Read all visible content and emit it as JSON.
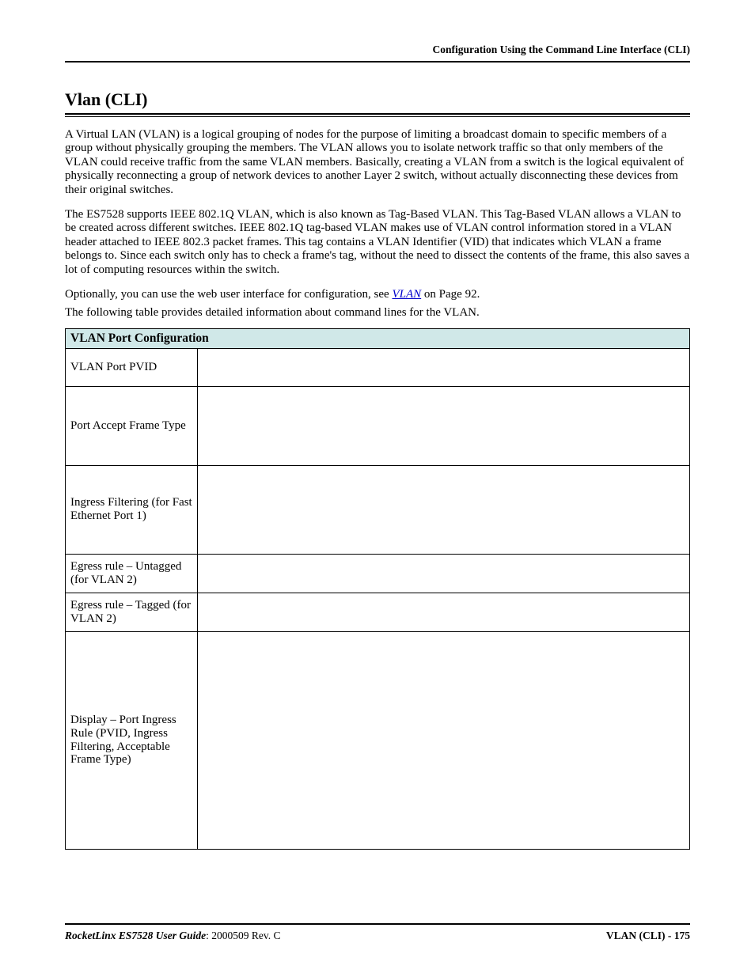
{
  "header": {
    "running_title": "Configuration Using the Command Line Interface (CLI)"
  },
  "section": {
    "title": "Vlan (CLI)",
    "para1": "A Virtual LAN (VLAN) is a logical grouping of nodes for the purpose of limiting a broadcast domain to specific members of a group without physically grouping the members. The VLAN allows you to isolate network traffic so that only members of the VLAN could receive traffic from the same VLAN members. Basically, creating a VLAN from a switch is the logical equivalent of physically reconnecting a group of network devices to another Layer 2 switch, without actually disconnecting these devices from their original switches.",
    "para2": "The ES7528 supports IEEE 802.1Q VLAN, which is also known as Tag-Based VLAN. This Tag-Based VLAN allows a VLAN to be created across different switches. IEEE 802.1Q tag-based VLAN makes use of VLAN control information stored in a VLAN header attached to IEEE 802.3 packet frames. This tag contains a VLAN Identifier (VID) that indicates which VLAN a frame belongs to. Since each switch only has to check a frame's tag, without the need to dissect the contents of the frame, this also saves a lot of computing resources within the switch.",
    "para3_pre": "Optionally, you can use the web user interface for configuration, see ",
    "para3_link": "VLAN",
    "para3_post": " on Page 92.",
    "para4": "The following table provides detailed information about command lines for the VLAN."
  },
  "table": {
    "header": "VLAN Port Configuration",
    "rows": [
      {
        "label": "VLAN Port PVID"
      },
      {
        "label": "Port Accept Frame Type"
      },
      {
        "label": "Ingress Filtering (for Fast Ethernet Port 1)"
      },
      {
        "label": "Egress rule – Untagged (for VLAN 2)"
      },
      {
        "label": "Egress rule – Tagged (for VLAN 2)"
      },
      {
        "label": "Display – Port Ingress Rule (PVID, Ingress Filtering, Acceptable Frame Type)"
      }
    ]
  },
  "footer": {
    "left_italic": "RocketLinx ES7528  User Guide",
    "left_rest": ": 2000509 Rev. C",
    "right": "VLAN (CLI) - 175"
  }
}
